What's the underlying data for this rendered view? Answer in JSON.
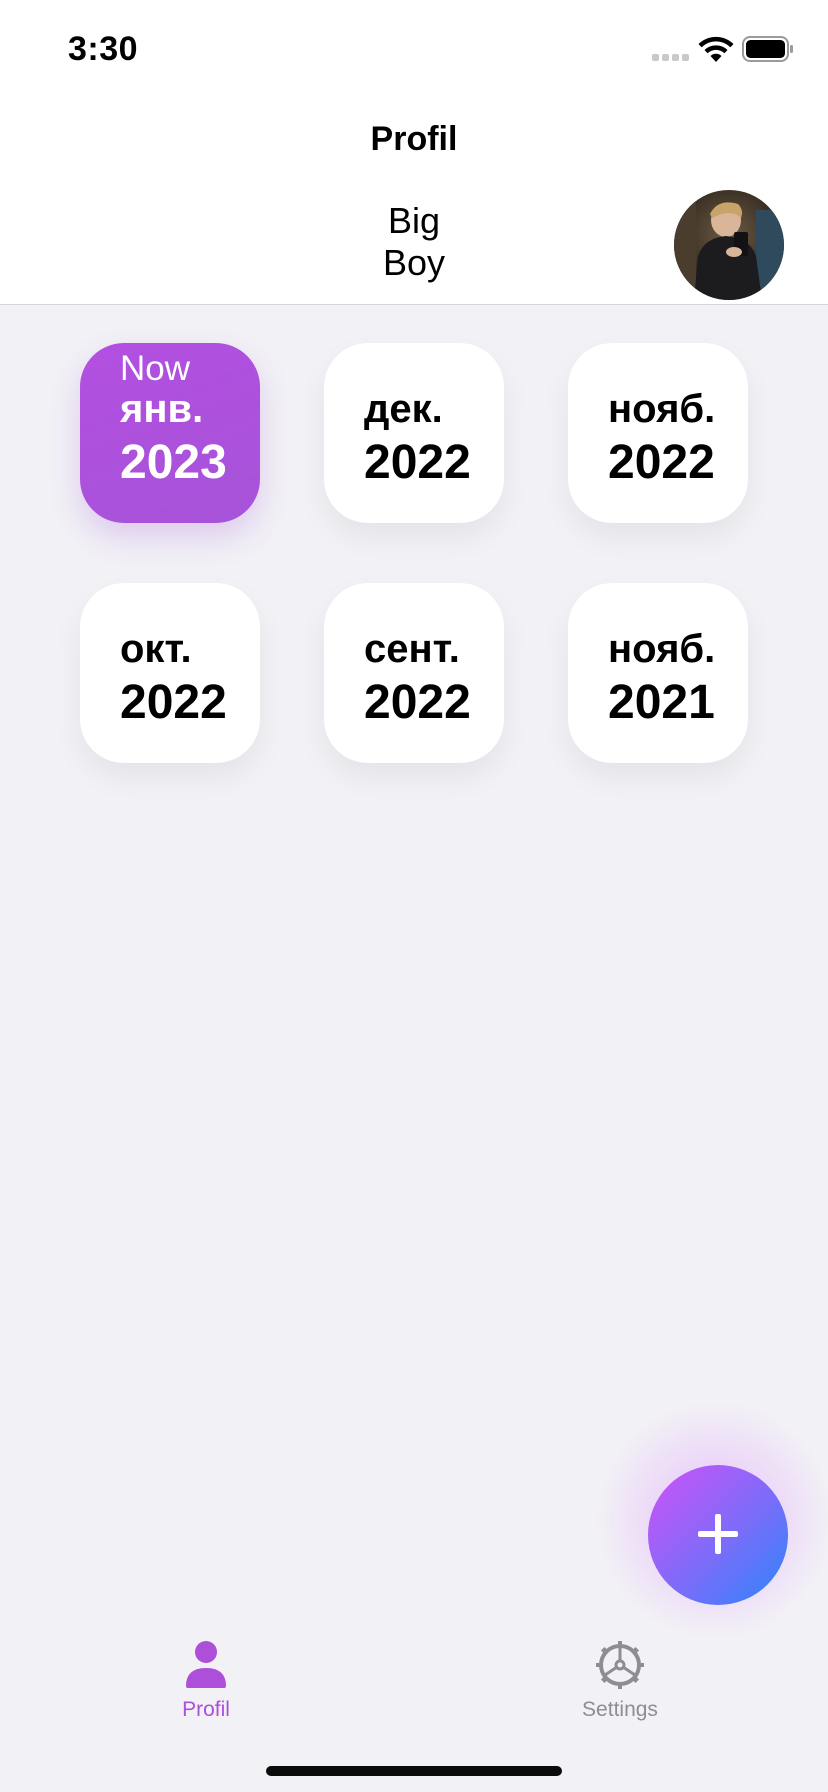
{
  "status_bar": {
    "time": "3:30"
  },
  "header": {
    "title": "Profil",
    "user_first_name": "Big",
    "user_last_name": "Boy"
  },
  "months": [
    {
      "now_label": "Now",
      "month": "янв.",
      "year": "2023",
      "active": true
    },
    {
      "month": "дек.",
      "year": "2022",
      "active": false
    },
    {
      "month": "нояб.",
      "year": "2022",
      "active": false
    },
    {
      "month": "окт.",
      "year": "2022",
      "active": false
    },
    {
      "month": "сент.",
      "year": "2022",
      "active": false
    },
    {
      "month": "нояб.",
      "year": "2021",
      "active": false
    }
  ],
  "fab": {
    "icon": "plus-icon"
  },
  "tab_bar": {
    "tabs": [
      {
        "label": "Profil",
        "icon": "person-icon",
        "active": true
      },
      {
        "label": "Settings",
        "icon": "gear-icon",
        "active": false
      }
    ]
  },
  "colors": {
    "accent": "#ad4fd9",
    "background": "#f2f1f6",
    "fab_gradient_start": "#cf52f8",
    "fab_gradient_end": "#2a86fb",
    "inactive_tab": "#8d8d93"
  }
}
